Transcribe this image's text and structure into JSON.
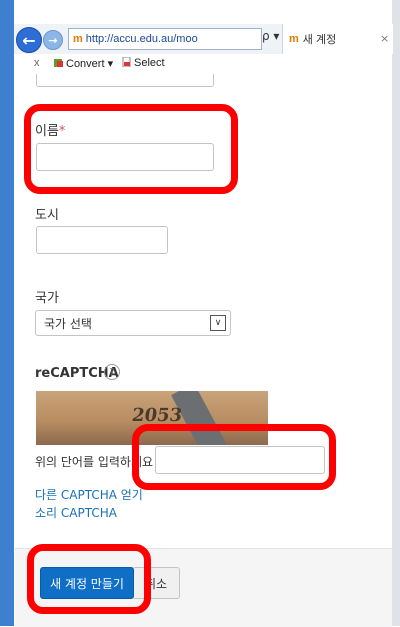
{
  "browser": {
    "url": "http://accu.edu.au/moo",
    "address_tools": "ρ ▾ ć",
    "tab_title": "새 계정",
    "tab_close": "×",
    "back_glyph": "←",
    "forward_glyph": "→",
    "favicon_glyph": "m"
  },
  "commandbar": {
    "close": "x",
    "convert_label": "Convert ▾",
    "select_label": "Select"
  },
  "form": {
    "name_label": "이름",
    "required_mark": "*",
    "city_label": "도시",
    "country_label": "국가",
    "country_selected": "국가 선택",
    "select_arrow": "∨",
    "recaptcha_label": "reCAPTCHA",
    "help_glyph": "?",
    "captcha_word": "2053",
    "captcha_input_label": "위의 단어를 입력하세요",
    "other_captcha_link": "다른 CAPTCHA 얻기",
    "audio_captcha_link": "소리 CAPTCHA",
    "create_button": "새 계정 만들기",
    "cancel_button": "취소"
  },
  "colors": {
    "highlight": "#ff0000",
    "primary_button": "#0f6fc6",
    "link": "#1a70b8"
  }
}
